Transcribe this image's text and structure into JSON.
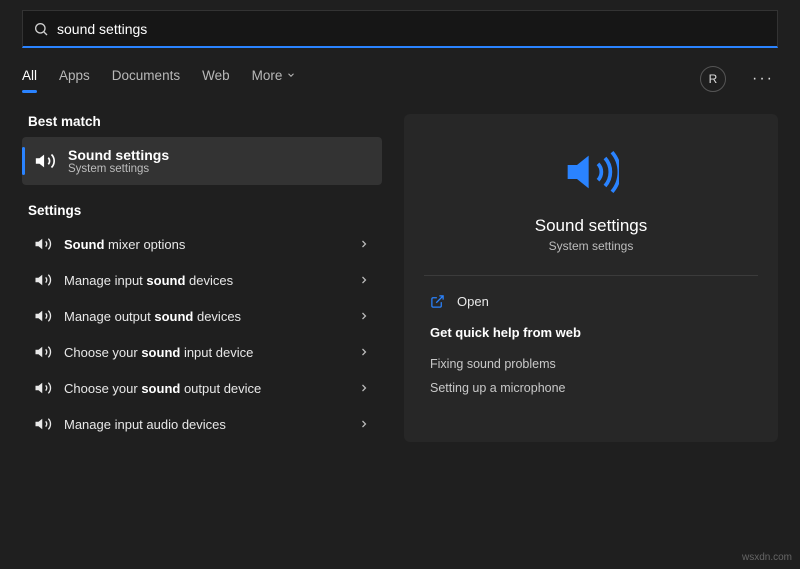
{
  "search": {
    "query": "sound settings"
  },
  "tabs": {
    "all": "All",
    "apps": "Apps",
    "documents": "Documents",
    "web": "Web",
    "more": "More"
  },
  "user_initial": "R",
  "sections": {
    "best_match": "Best match",
    "settings": "Settings"
  },
  "best": {
    "title": "Sound settings",
    "subtitle": "System settings"
  },
  "settings_items": [
    {
      "pre": "",
      "bold": "Sound",
      "post": " mixer options"
    },
    {
      "pre": "Manage input ",
      "bold": "sound",
      "post": " devices"
    },
    {
      "pre": "Manage output ",
      "bold": "sound",
      "post": " devices"
    },
    {
      "pre": "Choose your ",
      "bold": "sound",
      "post": " input device"
    },
    {
      "pre": "Choose your ",
      "bold": "sound",
      "post": " output device"
    },
    {
      "pre": "Manage input audio devices",
      "bold": "",
      "post": ""
    }
  ],
  "preview": {
    "title": "Sound settings",
    "subtitle": "System settings",
    "open": "Open",
    "help_heading": "Get quick help from web",
    "links": [
      "Fixing sound problems",
      "Setting up a microphone"
    ]
  },
  "watermark": "wsxdn.com"
}
